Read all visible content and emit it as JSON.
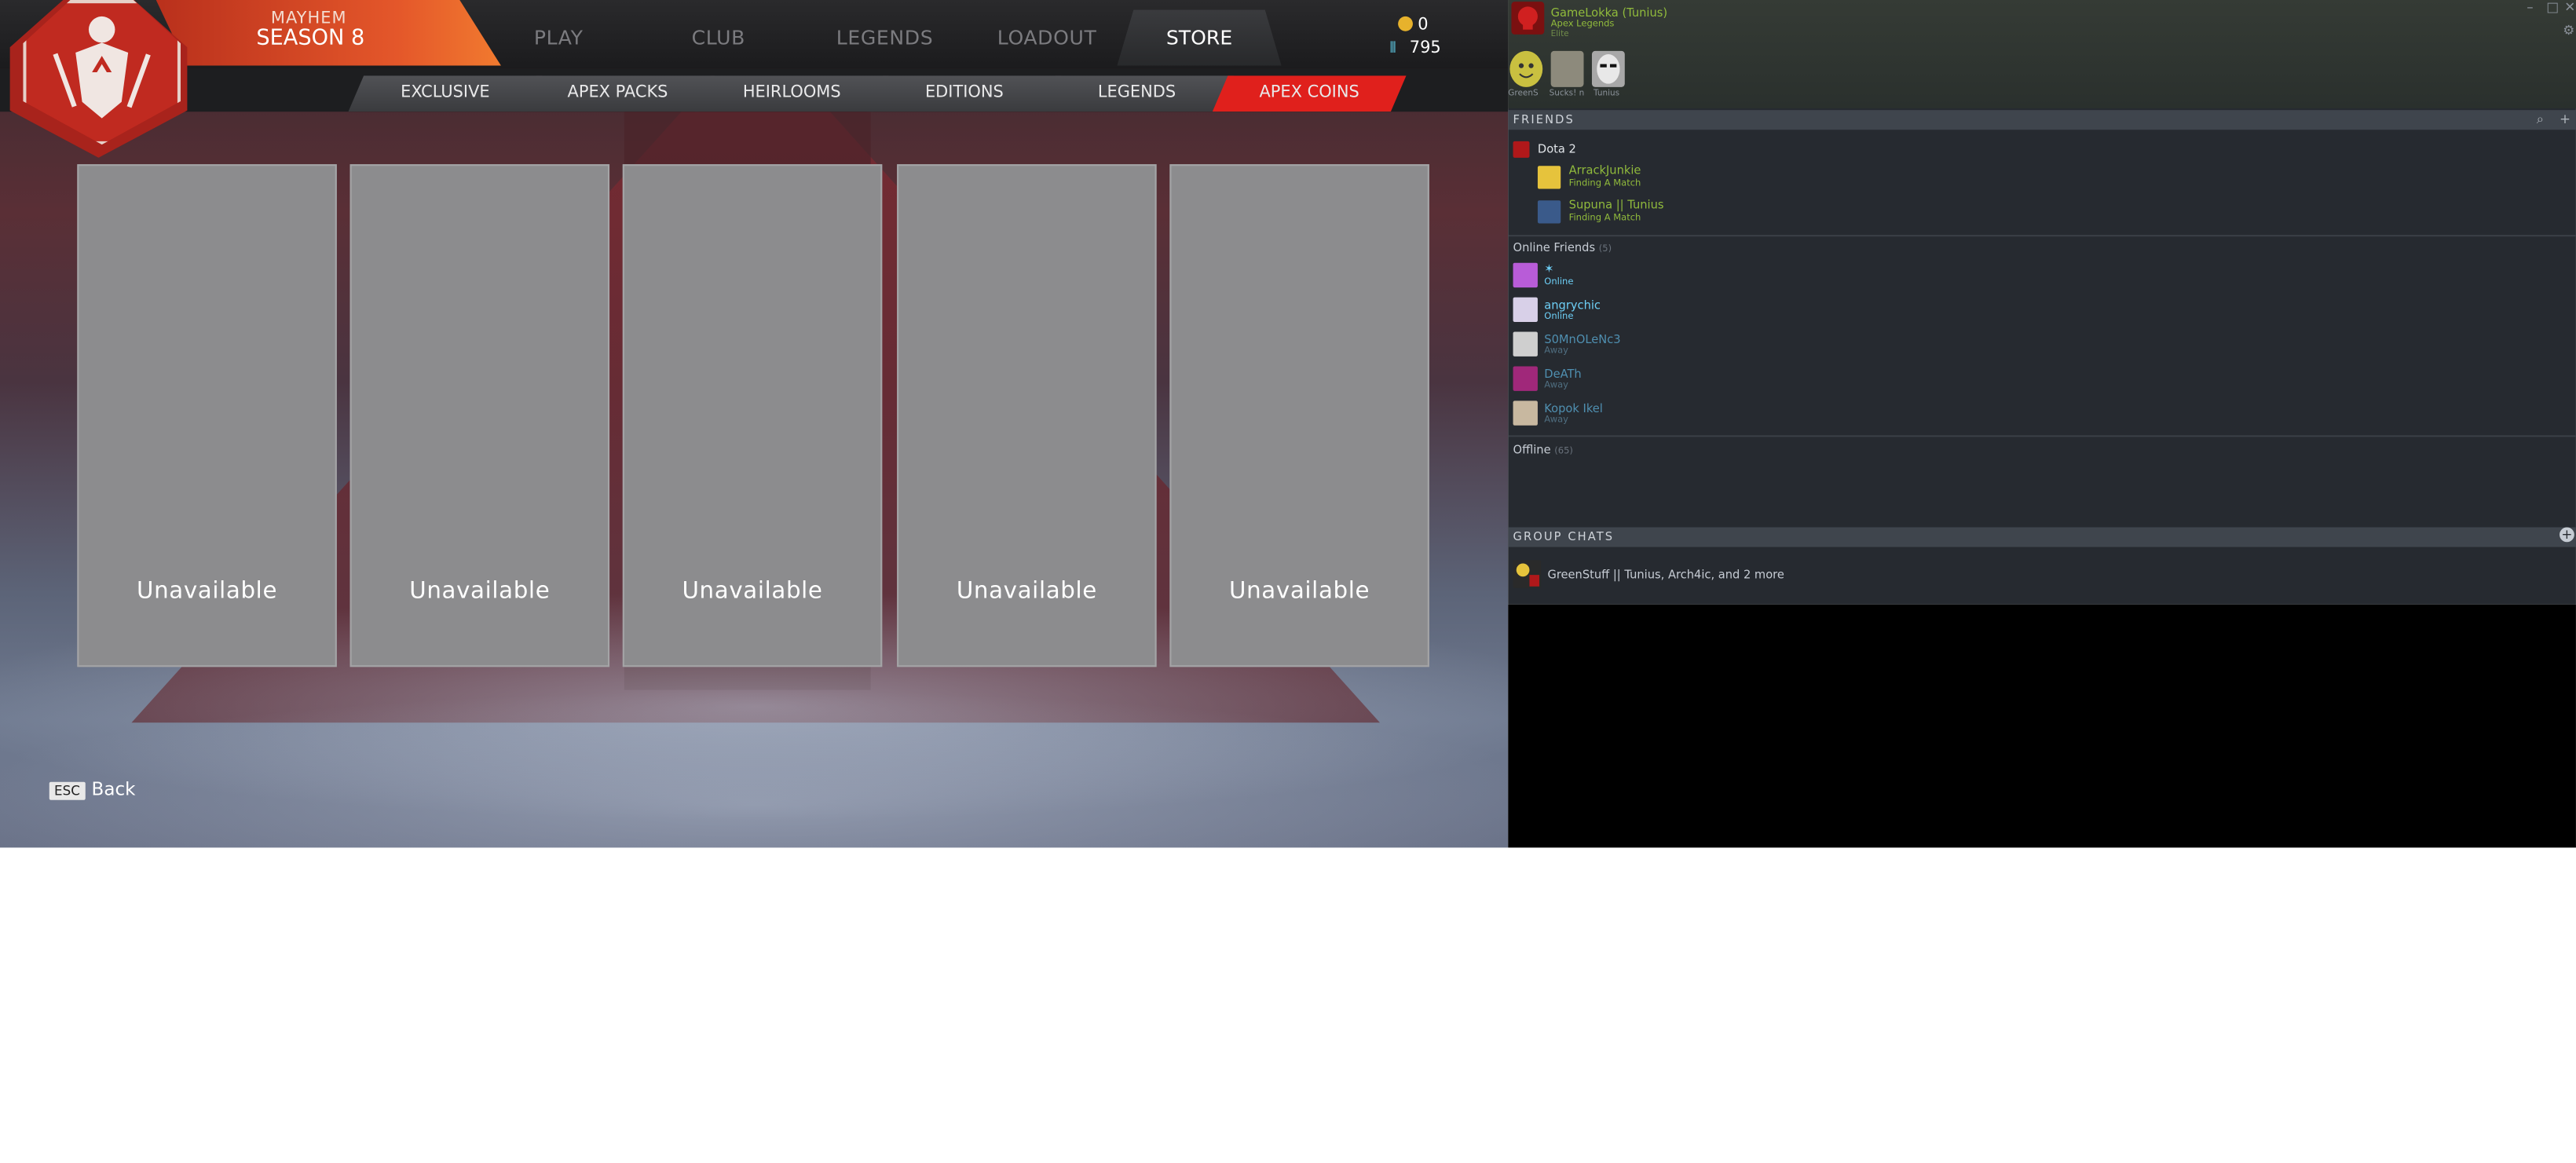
{
  "game": {
    "mode": "MAYHEM",
    "season": "SEASON 8",
    "nav": [
      {
        "label": "PLAY",
        "active": false
      },
      {
        "label": "CLUB",
        "active": false
      },
      {
        "label": "LEGENDS",
        "active": false
      },
      {
        "label": "LOADOUT",
        "active": false
      },
      {
        "label": "STORE",
        "active": true
      }
    ],
    "currency": {
      "apex_coins": "0",
      "crafting_metals": "795"
    },
    "subtabs": [
      {
        "label": "EXCLUSIVE",
        "active": false
      },
      {
        "label": "APEX PACKS",
        "active": false
      },
      {
        "label": "HEIRLOOMS",
        "active": false
      },
      {
        "label": "EDITIONS",
        "active": false
      },
      {
        "label": "LEGENDS",
        "active": false
      },
      {
        "label": "APEX COINS",
        "active": true
      }
    ],
    "cards": [
      {
        "label": "Unavailable"
      },
      {
        "label": "Unavailable"
      },
      {
        "label": "Unavailable"
      },
      {
        "label": "Unavailable"
      },
      {
        "label": "Unavailable"
      }
    ],
    "back": {
      "key": "ESC",
      "label": "Back"
    },
    "colors": {
      "accent_red": "#e0201c",
      "accent_orange": "#e4572a"
    }
  },
  "steam": {
    "user": {
      "name": "GameLokka (Tunius)",
      "status": "Apex Legends",
      "status2": "Elite"
    },
    "favorites": [
      {
        "label": "GreenS"
      },
      {
        "label": "Sucks! n"
      },
      {
        "label": "Tunius"
      }
    ],
    "friends_header": "FRIENDS",
    "ingame_group": {
      "game": "Dota 2",
      "members": [
        {
          "name": "ArrackJunkie",
          "status": "Finding A Match"
        },
        {
          "name": "Supuna || Tunius",
          "status": "Finding A Match"
        }
      ]
    },
    "online": {
      "label": "Online Friends",
      "count": "(5)",
      "friends": [
        {
          "name": "✶",
          "status": "Online"
        },
        {
          "name": "angrychic",
          "status": "Online"
        },
        {
          "name": "S0MnOLeNc3",
          "status": "Away"
        },
        {
          "name": "DeATh",
          "status": "Away"
        },
        {
          "name": "Kopok Ikel",
          "status": "Away"
        }
      ]
    },
    "offline": {
      "label": "Offline",
      "count": "(65)"
    },
    "group_chats_header": "GROUP CHATS",
    "group_chat": {
      "name": "GreenStuff || Tunius, Arch4ic, and 2 more"
    },
    "colors": {
      "name_blue": "#6dcff6",
      "ingame_green": "#90ba3c",
      "away": "#5a7a8c"
    }
  }
}
